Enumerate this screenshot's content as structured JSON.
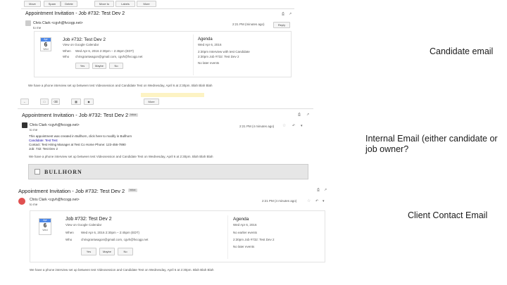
{
  "captions": {
    "candidate": "Candidate email",
    "internal": "Internal Email (either candidate or job owner?",
    "client": "Client Contact Email"
  },
  "email1": {
    "toolbar": [
      "Move",
      "Spam",
      "Delete",
      "Move to",
      "Labels",
      "More"
    ],
    "subject": "Appointment Invitation - Job #732: Test Dev 2",
    "sender": "Chris Clark <cgvh@fvcogp.net>",
    "to": "to me",
    "time": "2:21 PM (minutes ago)",
    "reply": "Reply",
    "cal_month": "Apr",
    "cal_day": "6",
    "cal_wday": "Wed",
    "event_title": "Job #732: Test Dev 2",
    "view_link": "View on Google Calendar",
    "when_label": "When",
    "when_value": "Wed Apr 6, 2016 2:30pm – 2:45pm (EDT)",
    "who_label": "Who",
    "who_value": "chrisgrantwagon@gmail.com, cgvh@fvcogp.net",
    "going": [
      "Yes",
      "Maybe",
      "No"
    ],
    "agenda_title": "Agenda",
    "agenda_date": "Wed Apr 6, 2016",
    "agenda_items": [
      "2:30pm  Interview with test Candidate",
      "2:30pm  Job #732: Test Dev 2",
      "No later events"
    ],
    "body": "We have a phone interview set up between test Videosession and Candidate Test on Wednesday, April 6 at 2:30pm. Blah Blah Blah"
  },
  "email2": {
    "subject": "Appointment Invitation - Job #732: Test Dev 2",
    "tag": "Inbox",
    "sender": "Chris Clark <cgvh@fvcogp.net>",
    "to": "to me",
    "time": "2:21 PM (4 minutes ago)",
    "line1": "This appointment was created in Bullhorn, click here to modify in Bullhorn",
    "line2": "Candidate: Test Test",
    "line3": "Contact: Test Hiring Manager at Test Co  Home Phone: 123-456-7890",
    "line4": "Job: 732: Test Dev 2",
    "body": "We have a phone interview set up between test Videosession and Candidate Test on Wednesday, April 6 at 2:30pm. Blah Blah Blah",
    "logo": "BULLHORN"
  },
  "email3": {
    "subject": "Appointment Invitation - Job #732: Test Dev 2",
    "tag": "Inbox",
    "sender": "Chris Clark <cgvh@fvcogp.net>",
    "to": "to me",
    "time": "2:21 PM (4 minutes ago)",
    "cal_month": "Apr",
    "cal_day": "6",
    "cal_wday": "Wed",
    "event_title": "Job #732: Test Dev 2",
    "view_link": "View on Google Calendar",
    "when_label": "When",
    "when_value": "Wed Apr 6, 2016 2:30pm – 2:45pm (EDT)",
    "who_label": "Who",
    "who_value": "chrisgrantwagon@gmail.com, cgvh@fvcogp.net",
    "going": [
      "Yes",
      "Maybe",
      "No"
    ],
    "agenda_title": "Agenda",
    "agenda_date": "Wed Apr 6, 2016",
    "agenda_items": [
      "No earlier events",
      "2:30pm  Job #732: Test Dev 2",
      "No later events"
    ],
    "body": "We have a phone interview set up between test Videosession and Candidate Test on Wednesday, April 6 at 2:30pm. Blah Blah Blah"
  }
}
